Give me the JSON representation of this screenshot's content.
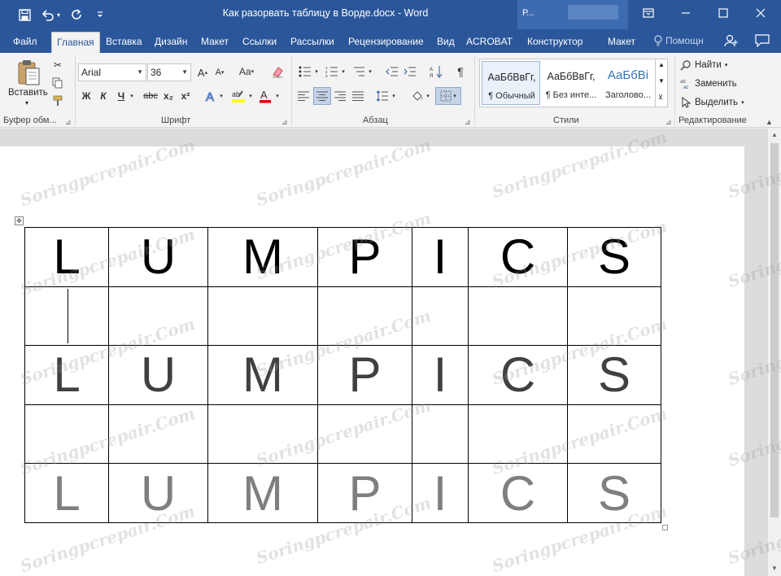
{
  "title_bar": {
    "doc_title": "Как разорвать таблицу в Ворде.docx - Word",
    "account_name": "Р...",
    "qat_icons": [
      "save-icon",
      "undo-icon",
      "redo-icon",
      "customize-qat-icon"
    ],
    "window_controls": [
      "ribbon-display-options-icon",
      "minimize-icon",
      "maximize-icon",
      "close-icon"
    ]
  },
  "tabs": [
    {
      "label": "Файл",
      "active": false
    },
    {
      "label": "Главная",
      "active": true
    },
    {
      "label": "Вставка",
      "active": false
    },
    {
      "label": "Дизайн",
      "active": false
    },
    {
      "label": "Макет",
      "active": false
    },
    {
      "label": "Ссылки",
      "active": false
    },
    {
      "label": "Рассылки",
      "active": false
    },
    {
      "label": "Рецензирование",
      "active": false
    },
    {
      "label": "Вид",
      "active": false
    },
    {
      "label": "ACROBAT",
      "active": false
    },
    {
      "label": "Конструктор",
      "active": false
    },
    {
      "label": "Макет",
      "active": false
    }
  ],
  "help": {
    "label": "Помощн"
  },
  "ribbon": {
    "clipboard": {
      "label": "Буфер обм...",
      "paste_label": "Вставить"
    },
    "font": {
      "label": "Шрифт",
      "font_name": "Arial",
      "font_size": "36",
      "change_case": "Aa",
      "bold": "Ж",
      "italic": "К",
      "underline": "Ч",
      "strike": "abc",
      "subscript": "x₂",
      "superscript": "x²"
    },
    "paragraph": {
      "label": "Абзац",
      "pilcrow": "¶"
    },
    "styles": {
      "label": "Стили",
      "items": [
        {
          "preview": "АаБбВвГг,",
          "name": "¶ Обычный",
          "color": "#000000"
        },
        {
          "preview": "АаБбВвГг,",
          "name": "¶ Без инте...",
          "color": "#000000"
        },
        {
          "preview": "АаБбВі",
          "name": "Заголово...",
          "color": "#2e74b5"
        }
      ]
    },
    "editing": {
      "label": "Редактирование",
      "find": "Найти",
      "replace": "Заменить",
      "select": "Выделить"
    }
  },
  "document": {
    "table": {
      "rows": [
        {
          "style": "black",
          "cells": [
            "L",
            "U",
            "M",
            "P",
            "I",
            "C",
            "S"
          ]
        },
        {
          "style": "empty",
          "cells": [
            "",
            "",
            "",
            "",
            "",
            "",
            ""
          ]
        },
        {
          "style": "dark",
          "cells": [
            "L",
            "U",
            "M",
            "P",
            "I",
            "C",
            "S"
          ]
        },
        {
          "style": "empty",
          "cells": [
            "",
            "",
            "",
            "",
            "",
            "",
            ""
          ]
        },
        {
          "style": "gray",
          "cells": [
            "L",
            "U",
            "M",
            "P",
            "I",
            "C",
            "S"
          ]
        }
      ]
    },
    "watermark_text": "Soringpcrepair.Com"
  },
  "colors": {
    "title_bar": "#2b579a",
    "ribbon": "#f3f3f3",
    "workspace": "#dcdcdc"
  }
}
